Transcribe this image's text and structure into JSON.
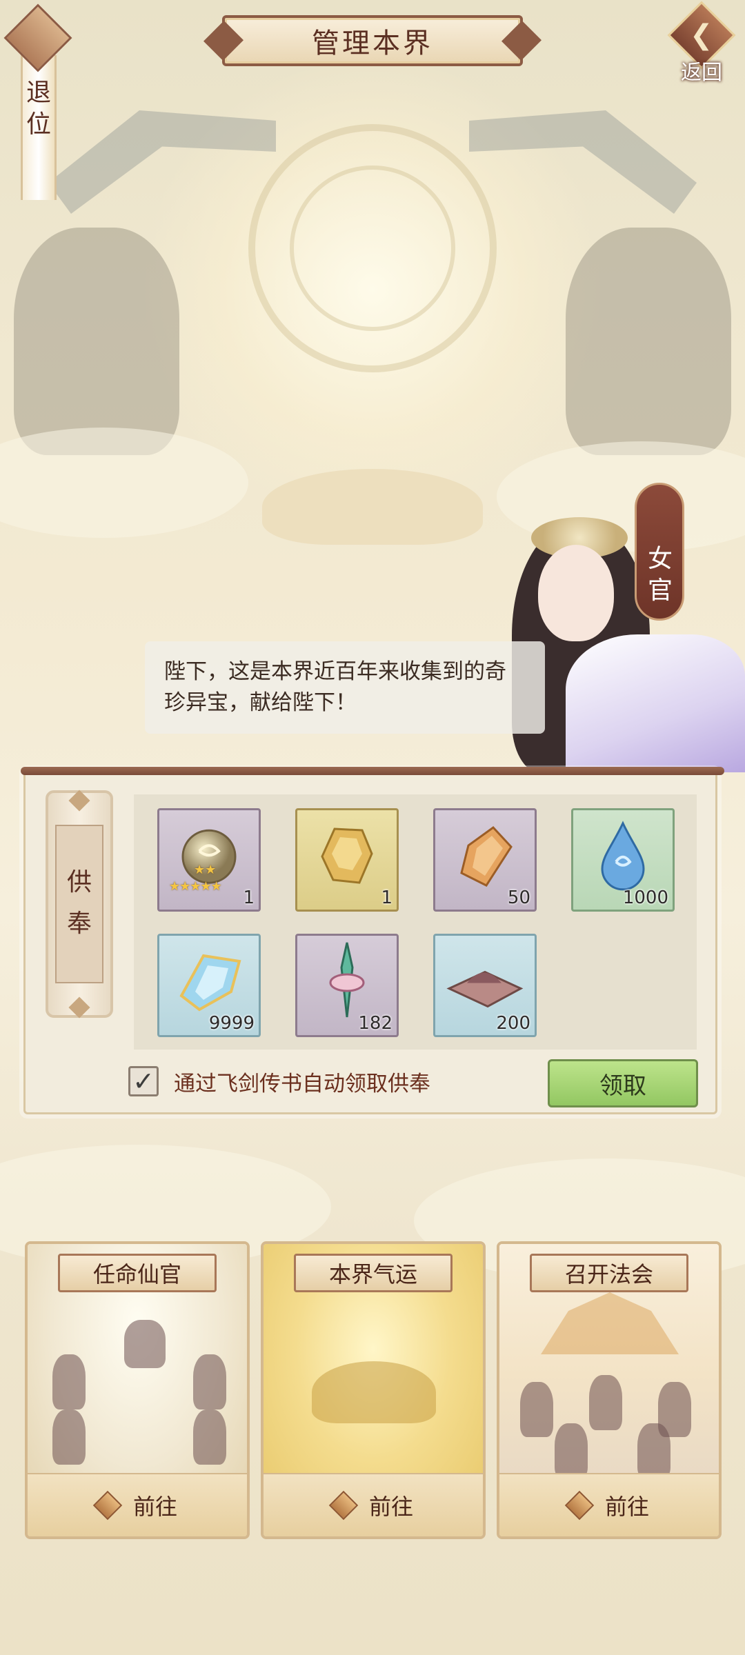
{
  "header": {
    "title": "管理本界",
    "retire_label": "退位",
    "back_label": "返回"
  },
  "dialog": {
    "speaker": "女官",
    "text": "陛下，这是本界近百年来收集到的奇珍异宝，献给陛下！"
  },
  "tribute": {
    "tab_label": "供奉",
    "items": [
      {
        "name": "star-orb",
        "count": "1",
        "stars": "★★★★★",
        "color": "purple"
      },
      {
        "name": "gold-ore",
        "count": "1",
        "color": "gold"
      },
      {
        "name": "amber-crystal",
        "count": "50",
        "color": "purple"
      },
      {
        "name": "water-drop",
        "count": "1000",
        "color": "green"
      },
      {
        "name": "ice-crystal",
        "count": "9999",
        "color": "blue"
      },
      {
        "name": "jade-sword",
        "count": "182",
        "color": "purple"
      },
      {
        "name": "earth-mound",
        "count": "200",
        "color": "blue"
      }
    ],
    "auto_claim_label": "通过飞剑传书自动领取供奉",
    "auto_claim_checked": true,
    "claim_button": "领取"
  },
  "cards": [
    {
      "title": "任命仙官",
      "action": "前往"
    },
    {
      "title": "本界气运",
      "action": "前往"
    },
    {
      "title": "召开法会",
      "action": "前往"
    }
  ]
}
